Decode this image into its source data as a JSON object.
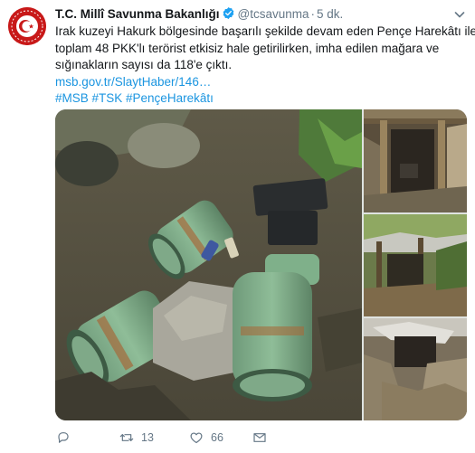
{
  "colors": {
    "link": "#1b95e0",
    "secondary_text": "#657786",
    "verified": "#1da1f2",
    "avatar_bg": "#c81919"
  },
  "tweet": {
    "author_name": "T.C. Millî Savunma Bakanlığı",
    "handle": "@tcsavunma",
    "separator": "·",
    "time": "5 dk.",
    "verified": true,
    "text_lines": [
      "Irak kuzeyi Hakurk bölgesinde başarılı şekilde devam eden Pençe Harekâtı ile",
      "toplam 48 PKK'lı terörist etkisiz hale getirilirken, imha edilen mağara ve",
      "sığınakların sayısı da 118'e çıktı."
    ],
    "link": "msb.gov.tr/SlaytHaber/146…",
    "hashtags": "#MSB #TSK #PençeHarekâtı"
  },
  "media": {
    "main_image": "photo of destroyed green gas cylinders, batteries and rocks",
    "thumbnails": [
      "cave shelter entrance with wooden beams",
      "camouflaged shelter under trees",
      "collapsed cave shelter"
    ]
  },
  "actions": {
    "reply_icon": "reply-icon",
    "retweet_icon": "retweet-icon",
    "retweet_count": "13",
    "like_icon": "heart-icon",
    "like_count": "66",
    "share_icon": "share-icon"
  }
}
